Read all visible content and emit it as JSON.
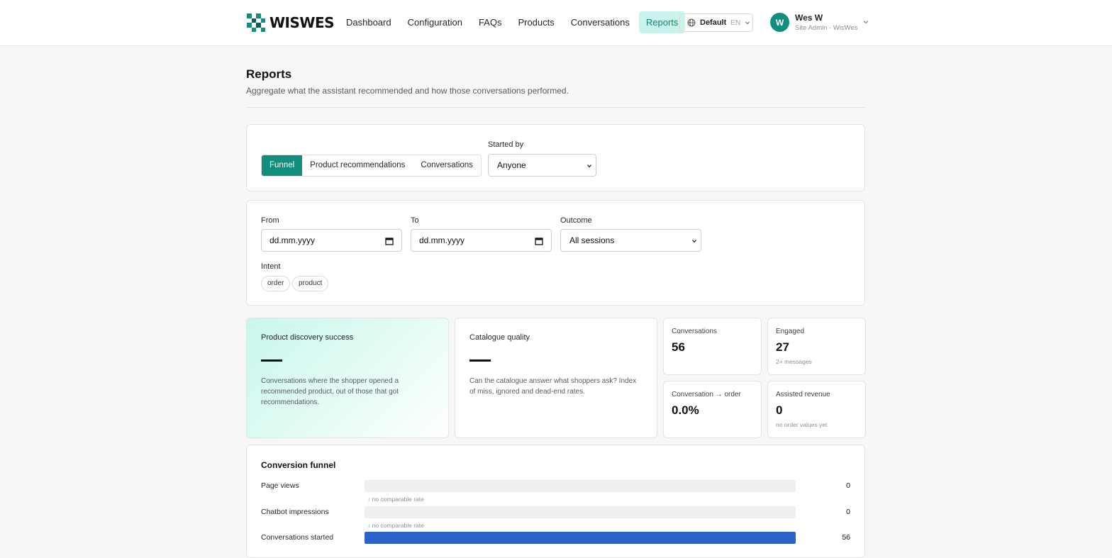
{
  "brand": {
    "name": "WISWES",
    "color": "#128f7c"
  },
  "nav": {
    "items": [
      {
        "label": "Dashboard",
        "active": false
      },
      {
        "label": "Configuration",
        "active": false
      },
      {
        "label": "FAQs",
        "active": false
      },
      {
        "label": "Products",
        "active": false
      },
      {
        "label": "Conversations",
        "active": false
      },
      {
        "label": "Reports",
        "active": true
      }
    ]
  },
  "workspace": {
    "name": "Default",
    "lang": "EN",
    "icon": "globe-icon"
  },
  "user": {
    "initial": "W",
    "name": "Wes W",
    "role": "Site Admin · WisWes"
  },
  "page": {
    "title": "Reports",
    "subtitle": "Aggregate what the assistant recommended and how those conversations performed."
  },
  "view": {
    "tabs": [
      {
        "label": "Funnel",
        "active": true
      },
      {
        "label": "Product recommendations",
        "active": false
      },
      {
        "label": "Conversations",
        "active": false
      }
    ],
    "started_by_label": "Started by",
    "started_by_value": "Anyone"
  },
  "filters": {
    "from_label": "From",
    "from_value": "dd.mm.yyyy",
    "to_label": "To",
    "to_value": "dd.mm.yyyy",
    "outcome_label": "Outcome",
    "outcome_value": "All sessions",
    "intent_label": "Intent",
    "intents": [
      "order",
      "product"
    ]
  },
  "kpis": {
    "discovery": {
      "title": "Product discovery success",
      "value": "—",
      "desc": "Conversations where the shopper opened a recommended product, out of those that got recommendations."
    },
    "catalogue": {
      "title": "Catalogue quality",
      "value": "—",
      "desc": "Can the catalogue answer what shoppers ask? Index of miss, ignored and dead-end rates."
    },
    "conversations": {
      "label": "Conversations",
      "value": "56"
    },
    "engaged": {
      "label": "Engaged",
      "value": "27",
      "note": "2+ messages"
    },
    "conversion": {
      "label": "Conversation → order",
      "value": "0.0%"
    },
    "revenue": {
      "label": "Assisted revenue",
      "value": "0",
      "note": "no order values yet"
    }
  },
  "funnel": {
    "title": "Conversion funnel",
    "bar_color": "#2a63c9",
    "steps": [
      {
        "label": "Page views",
        "value": "0",
        "fill": 0,
        "rate": "↓ no comparable rate"
      },
      {
        "label": "Chatbot impressions",
        "value": "0",
        "fill": 0,
        "rate": "↓ no comparable rate"
      },
      {
        "label": "Conversations started",
        "value": "56",
        "fill": 1,
        "rate": ""
      }
    ]
  }
}
